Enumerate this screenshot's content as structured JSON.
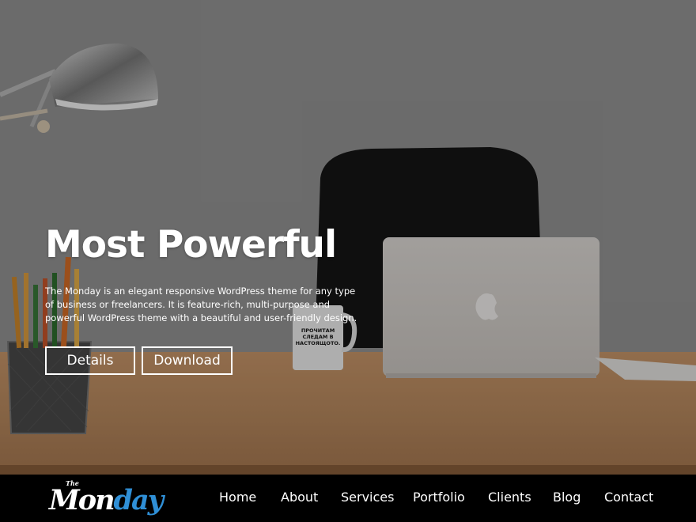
{
  "hero": {
    "title": "Most Powerful",
    "description": "The Monday is an elegant responsive WordPress theme for any type of business or freelancers. It is feature-rich, multi-purpose and powerful WordPress theme with a beautiful and user-friendly design.",
    "buttons": {
      "details": "Details",
      "download": "Download"
    },
    "mug_text": [
      "ПРОЧИТАМ",
      "СЛЕДАМ В",
      "НАСТОЯЩОТО."
    ]
  },
  "logo": {
    "the": "The",
    "mon": "Mon",
    "day": "day"
  },
  "nav": {
    "items": [
      "Home",
      "About",
      "Services",
      "Portfolio",
      "Clients",
      "Blog",
      "Contact"
    ]
  },
  "colors": {
    "accent": "#2f8fd6",
    "nav_bg": "#000000",
    "text": "#ffffff"
  }
}
